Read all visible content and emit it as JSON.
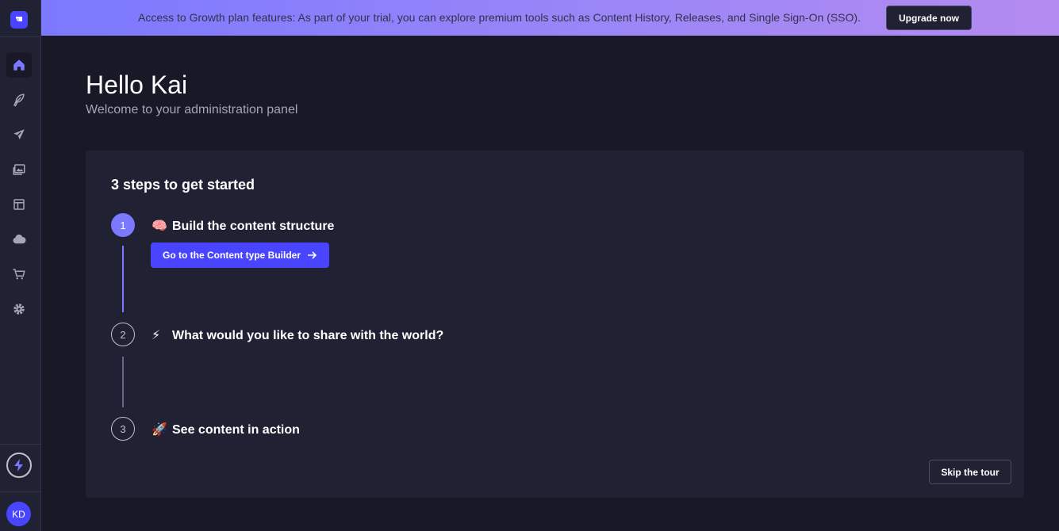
{
  "sidebar": {
    "logo_icon": "strapi-logo-icon",
    "items": [
      {
        "name": "home-icon",
        "active": true
      },
      {
        "name": "feather-icon",
        "active": false
      },
      {
        "name": "paper-plane-icon",
        "active": false
      },
      {
        "name": "images-icon",
        "active": false
      },
      {
        "name": "layout-icon",
        "active": false
      },
      {
        "name": "cloud-icon",
        "active": false
      },
      {
        "name": "shopping-cart-icon",
        "active": false
      },
      {
        "name": "gear-icon",
        "active": false
      }
    ],
    "growth_icon": "lightning-icon",
    "avatar_initials": "KD"
  },
  "banner": {
    "text": "Access to Growth plan features: As part of your trial, you can explore premium tools such as Content History, Releases, and Single Sign-On (SSO).",
    "button_label": "Upgrade now"
  },
  "header": {
    "title": "Hello Kai",
    "subtitle": "Welcome to your administration panel"
  },
  "guided_tour": {
    "title": "3 steps to get started",
    "steps": [
      {
        "number": "1",
        "emoji": "🧠",
        "label": "Build the content structure",
        "status": "current"
      },
      {
        "number": "2",
        "emoji": "⚡",
        "label": "What would you like to share with the world?",
        "status": "todo"
      },
      {
        "number": "3",
        "emoji": "🚀",
        "label": "See content in action",
        "status": "todo"
      }
    ],
    "cta_label": "Go to the Content type Builder",
    "skip_label": "Skip the tour"
  },
  "colors": {
    "accent": "#4945ff",
    "accent_light": "#7b79ff",
    "background": "#181826",
    "surface": "#212134"
  }
}
